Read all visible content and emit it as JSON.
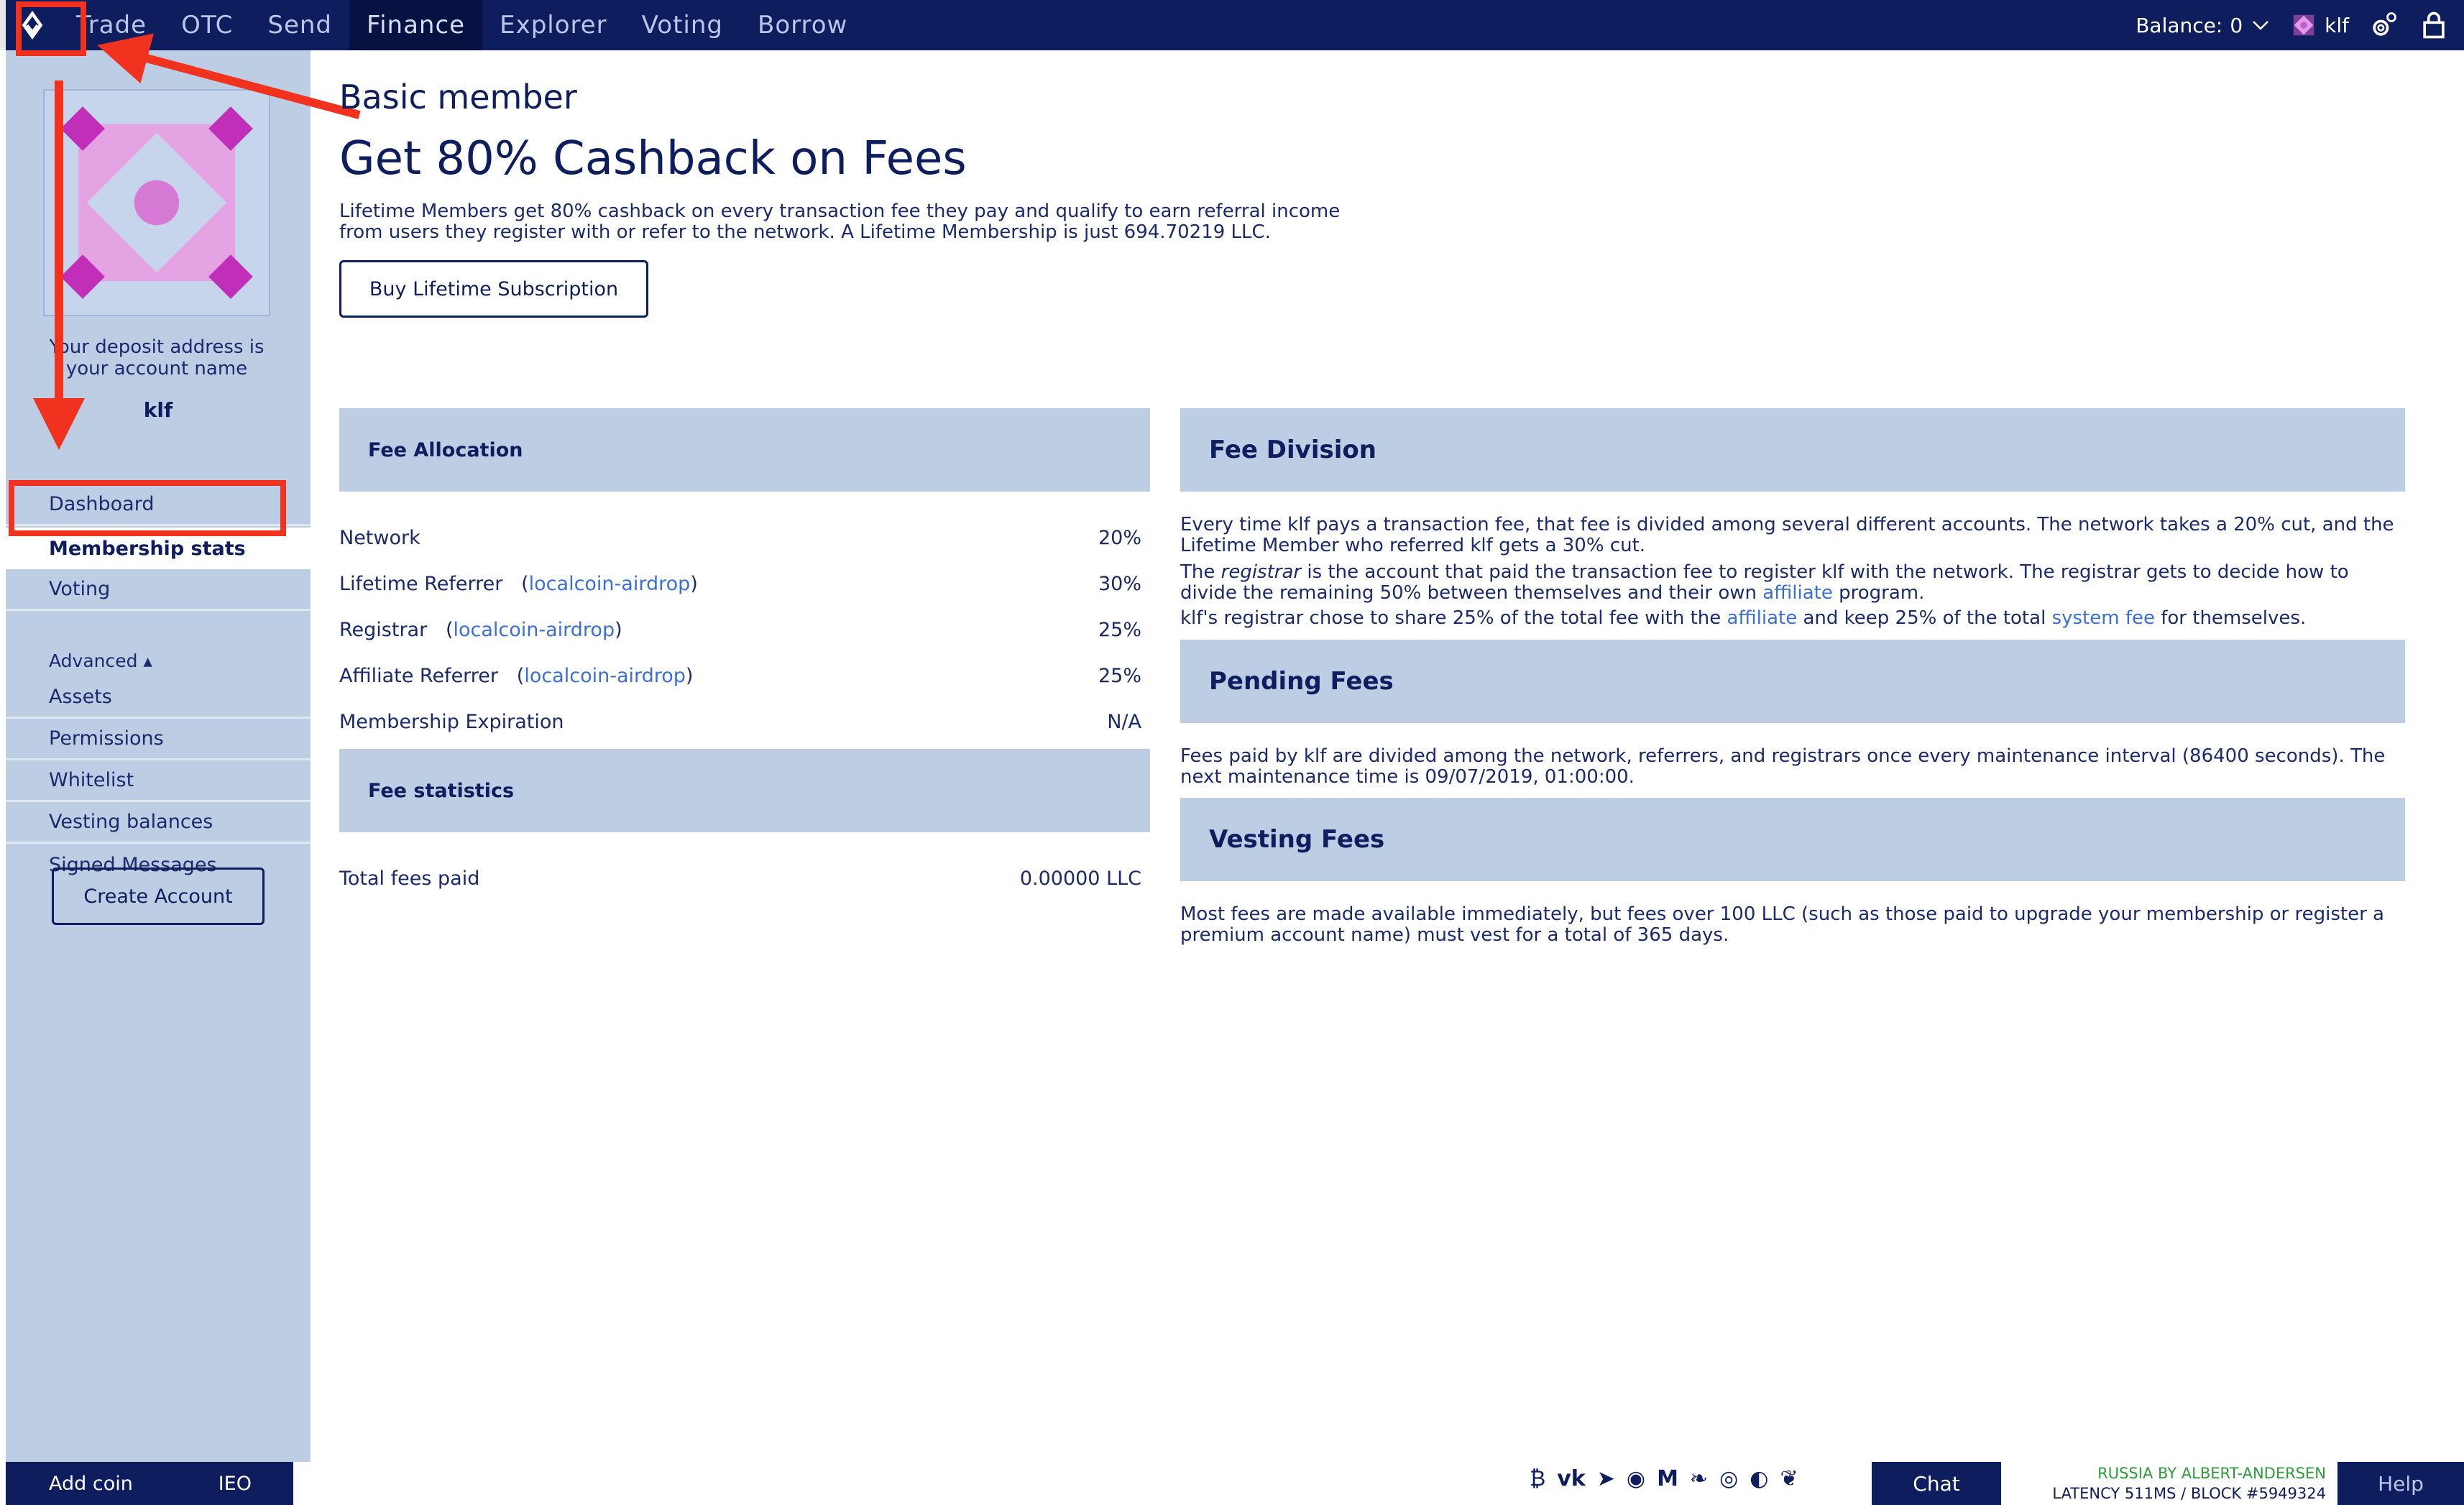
{
  "nav": {
    "items": [
      {
        "label": "Trade",
        "active": false
      },
      {
        "label": "OTC",
        "active": false
      },
      {
        "label": "Send",
        "active": false
      },
      {
        "label": "Finance",
        "active": true
      },
      {
        "label": "Explorer",
        "active": false
      },
      {
        "label": "Voting",
        "active": false
      },
      {
        "label": "Borrow",
        "active": false
      }
    ],
    "balance_label": "Balance:",
    "balance_value": "0",
    "account": "klf"
  },
  "sidebar": {
    "deposit_text_1": "Your deposit address is",
    "deposit_text_2": "your account name",
    "account_name": "klf",
    "items": [
      {
        "label": "Dashboard"
      },
      {
        "label": "Membership stats"
      },
      {
        "label": "Voting"
      },
      {
        "label": "Advanced ▴"
      },
      {
        "label": "Assets"
      },
      {
        "label": "Permissions"
      },
      {
        "label": "Whitelist"
      },
      {
        "label": "Vesting balances"
      },
      {
        "label": "Signed Messages"
      }
    ],
    "create_account": "Create Account"
  },
  "footer": {
    "add_coin": "Add coin",
    "ieo": "IEO",
    "chat": "Chat",
    "node_name": "RUSSIA BY ALBERT-ANDERSEN",
    "latency": "LATENCY 511MS / BLOCK #5949324",
    "help": "Help"
  },
  "main": {
    "membership_level": "Basic member",
    "headline": "Get 80% Cashback on Fees",
    "intro": "Lifetime Members get 80% cashback on every transaction fee they pay and qualify to earn referral income from users they register with or refer to the network. A Lifetime Membership is just 694.70219 LLC.",
    "buy_button": "Buy Lifetime Subscription",
    "fee_allocation": {
      "title": "Fee Allocation",
      "rows": [
        {
          "label": "Network",
          "link": "",
          "value": "20%"
        },
        {
          "label": "Lifetime Referrer",
          "link": "localcoin-airdrop",
          "value": "30%"
        },
        {
          "label": "Registrar",
          "link": "localcoin-airdrop",
          "value": "25%"
        },
        {
          "label": "Affiliate Referrer",
          "link": "localcoin-airdrop",
          "value": "25%"
        },
        {
          "label": "Membership Expiration",
          "link": "",
          "value": "N/A"
        }
      ]
    },
    "fee_statistics": {
      "title": "Fee statistics",
      "total_label": "Total fees paid",
      "total_value": "0.00000 LLC"
    },
    "fee_division": {
      "title": "Fee Division",
      "p1": "Every time klf pays a transaction fee, that fee is divided among several different accounts. The network takes a 20% cut, and the Lifetime Member who referred klf gets a 30% cut.",
      "p2_a": "The ",
      "p2_em": "registrar",
      "p2_b": " is the account that paid the transaction fee to register klf with the network. The registrar gets to decide how to divide the remaining 50% between themselves and their own ",
      "p2_link": "affiliate",
      "p2_c": " program.",
      "p3_a": "klf's registrar chose to share 25% of the total fee with the ",
      "p3_link1": "affiliate",
      "p3_b": " and keep 25% of the total ",
      "p3_link2": "system fee",
      "p3_c": " for themselves."
    },
    "pending_fees": {
      "title": "Pending Fees",
      "text": "Fees paid by klf are divided among the network, referrers, and registrars once every maintenance interval (86400 seconds). The next maintenance time is 09/07/2019, 01:00:00."
    },
    "vesting_fees": {
      "title": "Vesting Fees",
      "text": "Most fees are made available immediately, but fees over 100 LLC (such as those paid to upgrade your membership or register a premium account name) must vest for a total of 365 days."
    }
  }
}
